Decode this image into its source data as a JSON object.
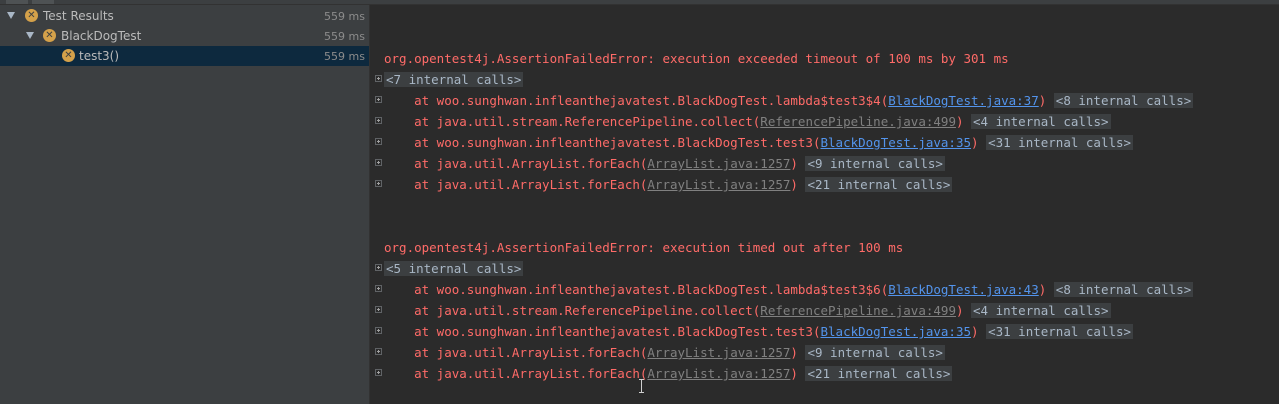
{
  "tree": {
    "root": {
      "label": "Test Results",
      "time": "559 ms"
    },
    "suite": {
      "label": "BlackDogTest",
      "time": "559 ms"
    },
    "test": {
      "label": "test3()",
      "time": "559 ms"
    }
  },
  "console": {
    "block1": {
      "header": "org.opentest4j.AssertionFailedError: execution exceeded timeout of 100 ms by 301 ms",
      "first_internal": "<7 internal calls>",
      "frames": [
        {
          "prefix": "    at woo.sunghwan.infleanthejavatest.BlackDogTest.lambda$test3$4(",
          "link": "BlackDogTest.java:37",
          "suffix": ")",
          "internal": "<8 internal calls>"
        },
        {
          "prefix": "    at java.util.stream.ReferencePipeline.collect(",
          "link": "ReferencePipeline.java:499",
          "suffix": ")",
          "internal": "<4 internal calls>"
        },
        {
          "prefix": "    at woo.sunghwan.infleanthejavatest.BlackDogTest.test3(",
          "link": "BlackDogTest.java:35",
          "suffix": ")",
          "internal": "<31 internal calls>"
        },
        {
          "prefix": "    at java.util.ArrayList.forEach(",
          "link": "ArrayList.java:1257",
          "suffix": ")",
          "internal": "<9 internal calls>"
        },
        {
          "prefix": "    at java.util.ArrayList.forEach(",
          "link": "ArrayList.java:1257",
          "suffix": ")",
          "internal": "<21 internal calls>"
        }
      ]
    },
    "block2": {
      "header": "org.opentest4j.AssertionFailedError: execution timed out after 100 ms",
      "first_internal": "<5 internal calls>",
      "frames": [
        {
          "prefix": "    at woo.sunghwan.infleanthejavatest.BlackDogTest.lambda$test3$6(",
          "link": "BlackDogTest.java:43",
          "suffix": ")",
          "internal": "<8 internal calls>"
        },
        {
          "prefix": "    at java.util.stream.ReferencePipeline.collect(",
          "link": "ReferencePipeline.java:499",
          "suffix": ")",
          "internal": "<4 internal calls>"
        },
        {
          "prefix": "    at woo.sunghwan.infleanthejavatest.BlackDogTest.test3(",
          "link": "BlackDogTest.java:35",
          "suffix": ")",
          "internal": "<31 internal calls>"
        },
        {
          "prefix": "    at java.util.ArrayList.forEach(",
          "link": "ArrayList.java:1257",
          "suffix": ")",
          "internal": "<9 internal calls>"
        },
        {
          "prefix": "    at java.util.ArrayList.forEach(",
          "link": "ArrayList.java:1257",
          "suffix": ")",
          "internal": "<21 internal calls>"
        }
      ]
    }
  }
}
